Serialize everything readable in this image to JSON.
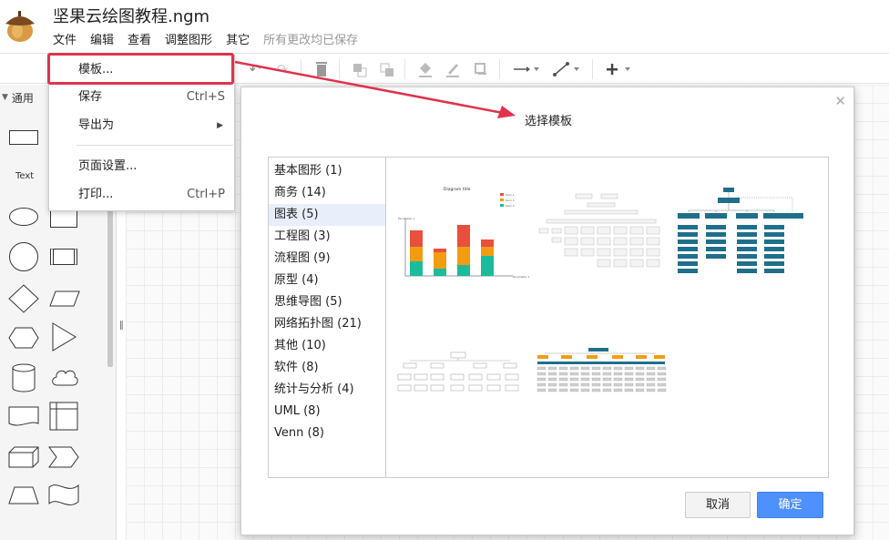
{
  "app": {
    "document_title": "坚果云绘图教程.ngm",
    "menus": [
      "文件",
      "编辑",
      "查看",
      "调整图形",
      "其它"
    ],
    "save_status": "所有更改均已保存"
  },
  "palette": {
    "section_label": "通用",
    "text_shape_label": "Text"
  },
  "file_menu": {
    "items": [
      {
        "label": "模板...",
        "shortcut": ""
      },
      {
        "label": "保存",
        "shortcut": "Ctrl+S"
      },
      {
        "label": "导出为",
        "shortcut": ""
      },
      {
        "label": "页面设置...",
        "shortcut": ""
      },
      {
        "label": "打印...",
        "shortcut": "Ctrl+P"
      }
    ]
  },
  "dialog": {
    "title": "选择模板",
    "categories": [
      "基本图形 (1)",
      "商务 (14)",
      "图表 (5)",
      "工程图 (3)",
      "流程图 (9)",
      "原型 (4)",
      "思维导图 (5)",
      "网络拓扑图 (21)",
      "其他 (10)",
      "软件 (8)",
      "统计与分析 (4)",
      "UML (8)",
      "Venn (8)"
    ],
    "selected_category": "图表 (5)",
    "cancel_label": "取消",
    "ok_label": "确定",
    "chart_thumb": {
      "title": "Diagram title",
      "legend": [
        "Item 1",
        "Item 2",
        "Item 3"
      ],
      "ylabel": "Parameter 1",
      "xlabel": "Parameter 2"
    }
  },
  "colors": {
    "accent_red": "#e0334d",
    "primary_blue": "#4d90fe",
    "org_teal": "#1f6f8b",
    "series": [
      "#e84f3c",
      "#f39c12",
      "#1abc9c"
    ]
  }
}
